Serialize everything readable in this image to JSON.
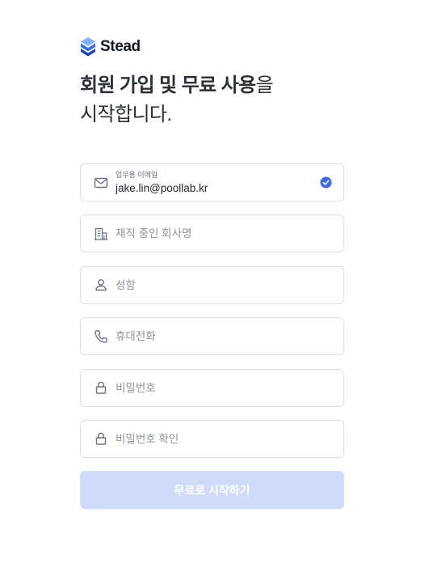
{
  "brand": {
    "name": "Stead",
    "accent": "#3b6cf0"
  },
  "headline": {
    "bold": "회원 가입 및 무료 사용",
    "light": "을",
    "line2": "시작합니다."
  },
  "form": {
    "email": {
      "label": "업무용 이메일",
      "value": "jake.lin@poollab.kr",
      "icon": "mail-icon",
      "status": "verified-check-icon"
    },
    "company": {
      "placeholder": "재직 중인 회사명",
      "icon": "building-icon"
    },
    "name": {
      "placeholder": "성함",
      "icon": "person-icon"
    },
    "phone": {
      "placeholder": "휴대전화",
      "icon": "phone-icon"
    },
    "password": {
      "placeholder": "비밀번호",
      "icon": "lock-icon"
    },
    "password_confirm": {
      "placeholder": "비밀번호 확인",
      "icon": "lock-icon"
    },
    "submit_label": "무료로 시작하기"
  },
  "colors": {
    "button_disabled": "#cfdcf9",
    "border": "#dcdfe5",
    "check": "#3b6cf0"
  }
}
